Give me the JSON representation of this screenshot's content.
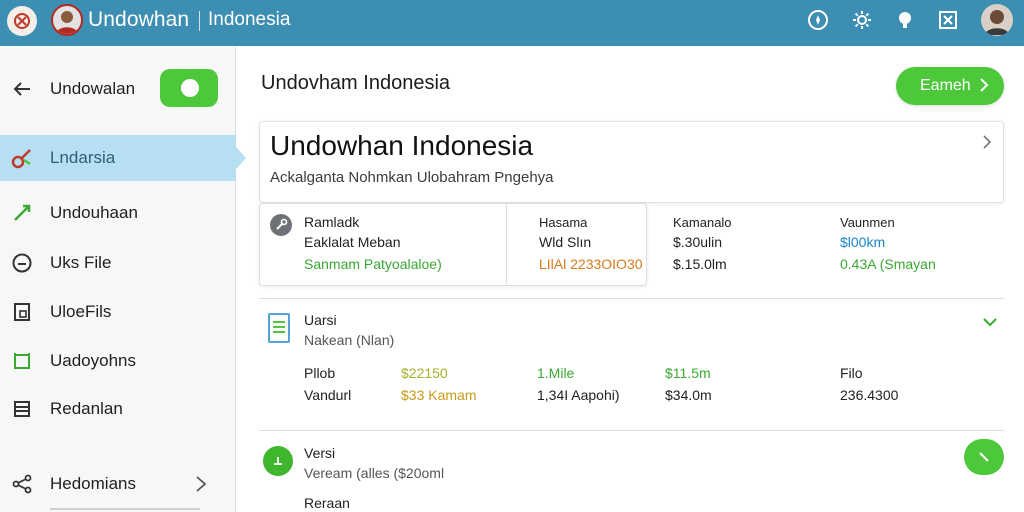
{
  "topbar": {
    "title": "Undowhan",
    "subtitle": "Indonesia",
    "icons": [
      "app-logo-icon",
      "avatar-icon",
      "compass-icon",
      "settings-icon",
      "bulb-icon",
      "bookmark-icon",
      "user-avatar-icon"
    ]
  },
  "sidebar": {
    "items": [
      {
        "label": "Undowalan",
        "icon": "back-arrow-icon"
      },
      {
        "label": "Lndarsia",
        "icon": "brush-icon"
      },
      {
        "label": "Undouhaan",
        "icon": "pin-icon"
      },
      {
        "label": "Uks File",
        "icon": "clock-icon"
      },
      {
        "label": "UloeFils",
        "icon": "document-icon"
      },
      {
        "label": "Uadoyohns",
        "icon": "frame-icon"
      },
      {
        "label": "Redanlan",
        "icon": "list-icon"
      },
      {
        "label": "Hedomians",
        "icon": "share-icon"
      }
    ],
    "toggle_on": true
  },
  "main": {
    "title": "Undovham Indonesia",
    "primary_button": "Eameh",
    "hero": {
      "title": "Undowhan Indonesia",
      "subtitle": "Ackalganta Nohmkan Ulobahram Pngehya"
    },
    "detail": {
      "col1": [
        "Ramladk",
        "Eaklalat Meban",
        "Sanmam Patyoalaloe)"
      ],
      "col2": [
        "Hasama",
        "Wld Slın",
        "LIlAl 2233OIO30"
      ],
      "col3": [
        "Kamanalo",
        "$.30ulin",
        "$.15.0lm"
      ],
      "col4": [
        "Vaunmen",
        "$l00km",
        "0.43A (Smayan"
      ]
    },
    "section1": {
      "title": "Uarsi",
      "subtitle": "Nakean (Nlan)",
      "row1": [
        "Pllob",
        "$22150",
        "1.Mile",
        "$11.5m",
        "Filo"
      ],
      "row2": [
        "Vandurl",
        "$33 Kamam",
        "1,34I Aapohi)",
        "$34.0m",
        "236.4300"
      ]
    },
    "section2": {
      "title": "Versi",
      "subtitle": "Veream (alles ($20oml",
      "extra": "Reraan"
    }
  },
  "colors": {
    "topbar": "#3d8eb3",
    "accent_green": "#4cc83a",
    "sidebar_active": "#b6dff3",
    "link_blue": "#1a86c8",
    "orange": "#d97a1c"
  }
}
